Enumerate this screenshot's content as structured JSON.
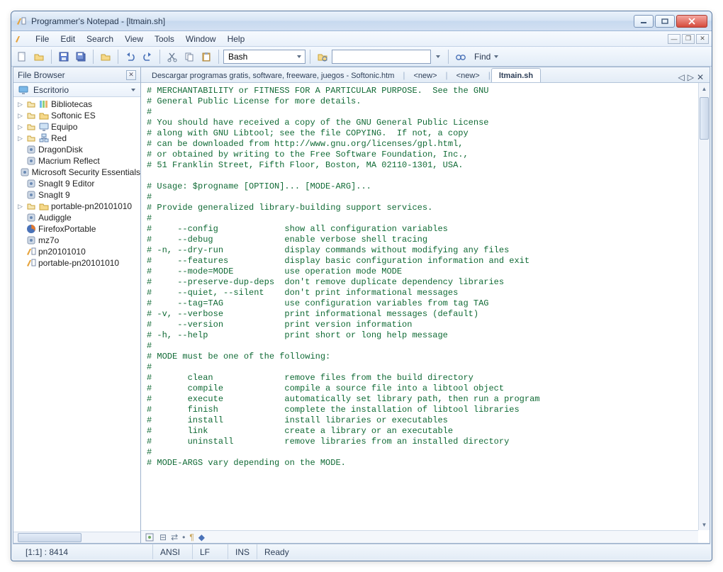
{
  "title": "Programmer's Notepad - [ltmain.sh]",
  "menus": [
    "File",
    "Edit",
    "Search",
    "View",
    "Tools",
    "Window",
    "Help"
  ],
  "toolbar": {
    "language": "Bash",
    "find_label": "Find"
  },
  "sidebar": {
    "title": "File Browser",
    "root": "Escritorio",
    "items": [
      {
        "icon": "library",
        "label": "Bibliotecas",
        "twisty": true
      },
      {
        "icon": "folder",
        "label": "Softonic ES",
        "twisty": true
      },
      {
        "icon": "computer",
        "label": "Equipo",
        "twisty": true
      },
      {
        "icon": "network",
        "label": "Red",
        "twisty": true
      },
      {
        "icon": "app",
        "label": "DragonDisk",
        "twisty": false
      },
      {
        "icon": "app",
        "label": "Macrium Reflect",
        "twisty": false
      },
      {
        "icon": "app",
        "label": "Microsoft Security Essentials",
        "twisty": false
      },
      {
        "icon": "app",
        "label": "SnagIt 9 Editor",
        "twisty": false
      },
      {
        "icon": "app",
        "label": "SnagIt 9",
        "twisty": false
      },
      {
        "icon": "folder",
        "label": "portable-pn20101010",
        "twisty": true
      },
      {
        "icon": "app",
        "label": "Audiggle",
        "twisty": false
      },
      {
        "icon": "firefox",
        "label": "FirefoxPortable",
        "twisty": false
      },
      {
        "icon": "app",
        "label": "mz7o",
        "twisty": false
      },
      {
        "icon": "pn",
        "label": "pn20101010",
        "twisty": false
      },
      {
        "icon": "pn",
        "label": "portable-pn20101010",
        "twisty": false
      }
    ]
  },
  "tabs": [
    {
      "label": "Descargar programas gratis, software, freeware, juegos - Softonic.htm",
      "active": false
    },
    {
      "label": "<new>",
      "active": false
    },
    {
      "label": "<new>",
      "active": false
    },
    {
      "label": "ltmain.sh",
      "active": true
    }
  ],
  "code": "# MERCHANTABILITY or FITNESS FOR A PARTICULAR PURPOSE.  See the GNU\n# General Public License for more details.\n#\n# You should have received a copy of the GNU General Public License\n# along with GNU Libtool; see the file COPYING.  If not, a copy\n# can be downloaded from http://www.gnu.org/licenses/gpl.html,\n# or obtained by writing to the Free Software Foundation, Inc.,\n# 51 Franklin Street, Fifth Floor, Boston, MA 02110-1301, USA.\n\n# Usage: $progname [OPTION]... [MODE-ARG]...\n#\n# Provide generalized library-building support services.\n#\n#     --config             show all configuration variables\n#     --debug              enable verbose shell tracing\n# -n, --dry-run            display commands without modifying any files\n#     --features           display basic configuration information and exit\n#     --mode=MODE          use operation mode MODE\n#     --preserve-dup-deps  don't remove duplicate dependency libraries\n#     --quiet, --silent    don't print informational messages\n#     --tag=TAG            use configuration variables from tag TAG\n# -v, --verbose            print informational messages (default)\n#     --version            print version information\n# -h, --help               print short or long help message\n#\n# MODE must be one of the following:\n#\n#       clean              remove files from the build directory\n#       compile            compile a source file into a libtool object\n#       execute            automatically set library path, then run a program\n#       finish             complete the installation of libtool libraries\n#       install            install libraries or executables\n#       link               create a library or an executable\n#       uninstall          remove libraries from an installed directory\n#\n# MODE-ARGS vary depending on the MODE.",
  "status": {
    "pos": "[1:1] : 8414",
    "enc": "ANSI",
    "eol": "LF",
    "mode": "INS",
    "msg": "Ready"
  }
}
